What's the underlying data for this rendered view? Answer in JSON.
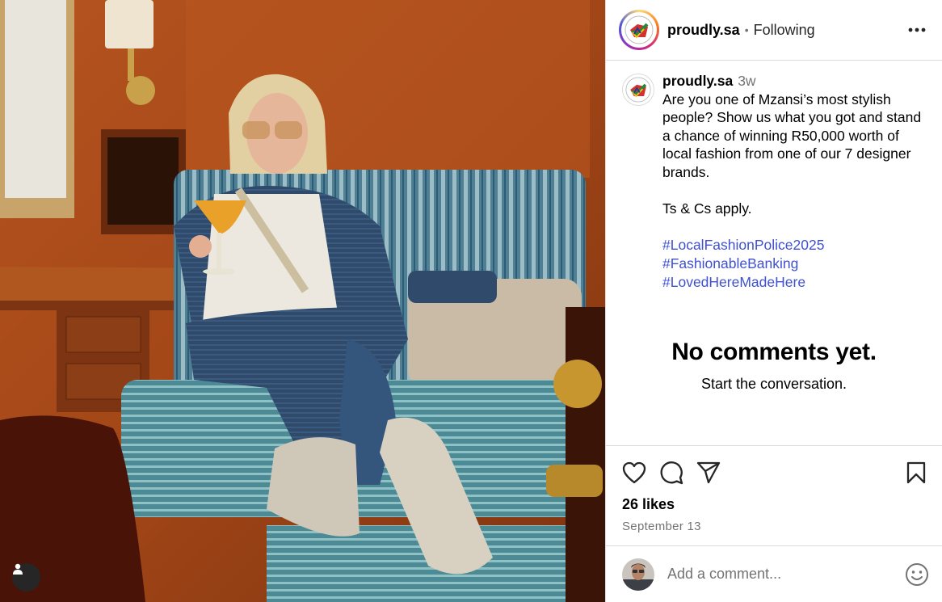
{
  "post": {
    "username": "proudly.sa",
    "follow_status": "Following",
    "header_separator": "•",
    "time_ago": "3w",
    "caption": "Are you one of Mzansi’s most stylish people? Show us what you got and stand a chance of winning R50,000 worth of local fashion from one of our 7 designer brands.\n\nTs & Cs apply.",
    "hashtags": [
      "#LocalFashionPolice2025",
      "#FashionableBanking",
      "#LovedHereMadeHere"
    ],
    "empty_title": "No comments yet.",
    "empty_subtitle": "Start the conversation.",
    "likes": "26 likes",
    "date": "September 13",
    "comment_placeholder": "Add a comment..."
  },
  "icons": {
    "more": "more-horizontal-icon",
    "like": "heart-icon",
    "comment": "comment-icon",
    "share": "send-icon",
    "save": "bookmark-icon",
    "emoji": "smiley-icon",
    "tag": "user-tag-icon"
  },
  "colors": {
    "hashtag": "#3f51d1",
    "secondary_text": "#737373",
    "divider": "#dbdbdb"
  }
}
